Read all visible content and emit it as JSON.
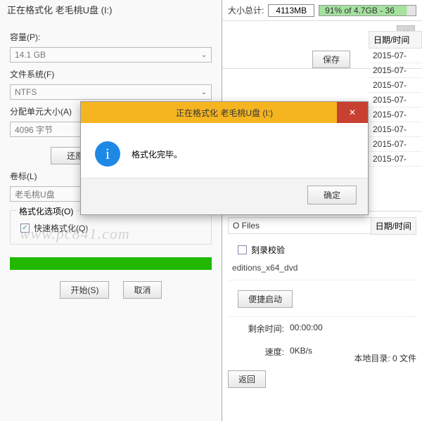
{
  "format": {
    "title": "正在格式化 老毛桃U盘 (I:)",
    "capacity_label": "容量(P):",
    "capacity_value": "14.1 GB",
    "filesystem_label": "文件系统(F)",
    "filesystem_value": "NTFS",
    "allocation_label": "分配单元大小(A)",
    "allocation_value": "4096 字节",
    "restore_btn": "还原设备的默认设置(D)",
    "volume_label": "卷标(L)",
    "volume_value": "老毛桃U盘",
    "options_label": "格式化选项(O)",
    "quick_format": "快速格式化(Q)",
    "start_btn": "开始(S)",
    "cancel_btn": "取消"
  },
  "right": {
    "size_label": "大小总计:",
    "size_value": "4113MB",
    "progress_text": "91% of 4.7GB - 36",
    "save_btn": "保存",
    "date_header": "日期/时间",
    "dates": [
      "2015-07-",
      "2015-07-",
      "2015-07-",
      "2015-07-",
      "2015-07-",
      "2015-07-",
      "2015-07-",
      "2015-07-"
    ],
    "iso_files": "O Files",
    "date_header2": "日期/时间",
    "verify_label": "刻录校验",
    "editions_text": "editions_x64_dvd",
    "portable_btn": "便捷启动",
    "remain_label": "剩余时间:",
    "remain_value": "00:00:00",
    "speed_label": "速度:",
    "speed_value": "0KB/s",
    "back_btn": "返回",
    "local_dir": "本地目录: 0 文件"
  },
  "modal": {
    "title": "正在格式化 老毛桃U盘 (I:)",
    "message": "格式化完毕。",
    "ok_btn": "确定"
  },
  "watermark": "www.pc841.com"
}
